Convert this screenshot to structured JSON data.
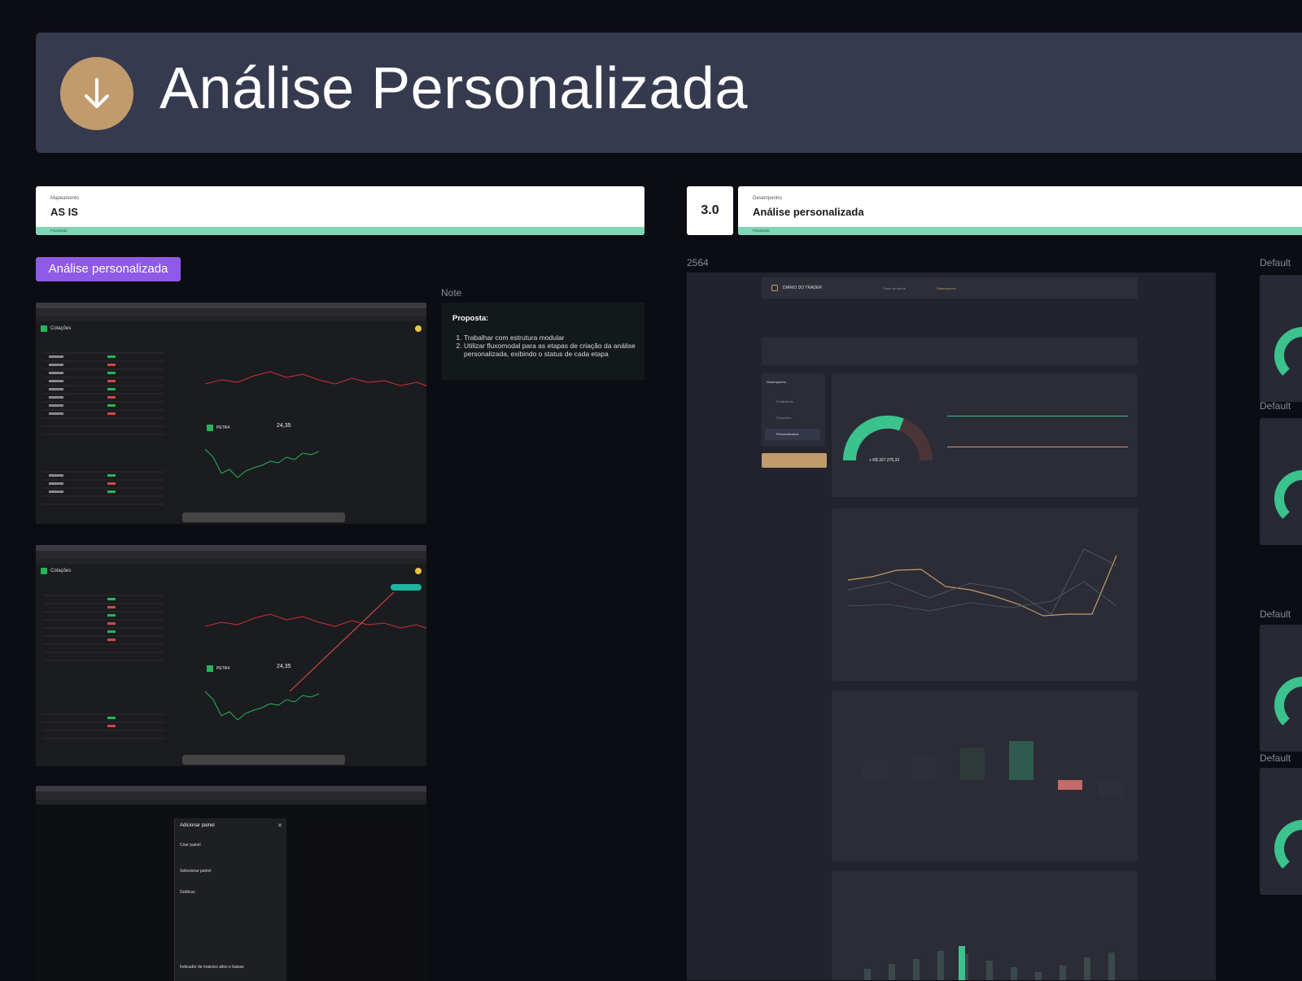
{
  "header": {
    "title": "Análise Personalizada",
    "icon": "arrow-down-icon"
  },
  "card_as_is": {
    "section": "Mapeamento",
    "title": "AS IS",
    "status": "Finalizada"
  },
  "version": "3.0",
  "card_perf": {
    "section": "Desempenho",
    "title": "Análise personalizada",
    "status": "Finalizada"
  },
  "pill_label": "Análise personalizada",
  "labels": {
    "note": "Note",
    "size": "2564",
    "default": "Default"
  },
  "note": {
    "title": "Proposta:",
    "items": [
      "Trabalhar com estrutura modular",
      "Utilizar fluxomodal para as etapas de criação da análise personalizada, exibindo o status de cada etapa"
    ]
  },
  "shots": {
    "brand": "Cotações",
    "quote_ticker": "PETR4",
    "quote_price": "24,35",
    "modal": {
      "title": "Adicionar painel",
      "options": [
        "Criar painel",
        "Selecionar painel",
        "Gráficos",
        "Indicador de maiores altos e baixas"
      ]
    }
  },
  "dashboard": {
    "brand": "DIÁRIO DO TRADER",
    "nav": [
      "Base de dados",
      "Desempenho"
    ],
    "side_title": "Desempenho",
    "side_items": [
      "Estatísticas",
      "Financeiro",
      "Personalizados"
    ],
    "gauge_value": "+ R$ 327.275,32"
  },
  "colors": {
    "accent": "#c19b6c",
    "purple": "#8e5ae6",
    "green": "#3bc28d",
    "bar": "#7fd6b5"
  }
}
